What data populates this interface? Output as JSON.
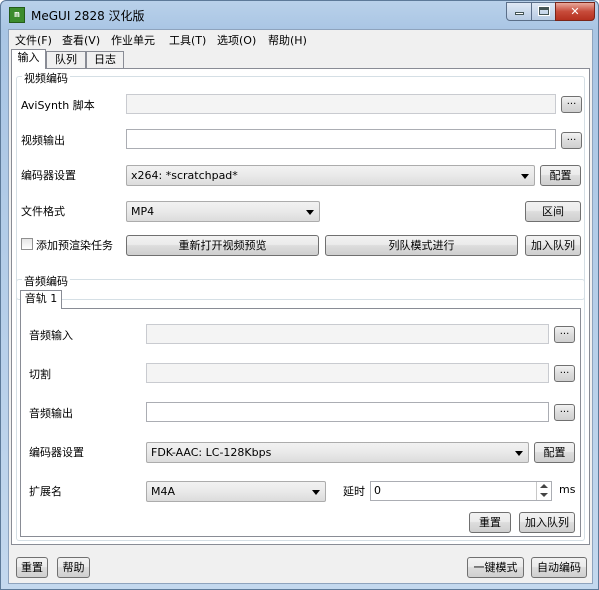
{
  "window": {
    "title": "MeGUI 2828 汉化版",
    "icon_text": "m"
  },
  "menu": [
    "文件(F)",
    "查看(V)",
    "作业单元",
    "工具(T)",
    "选项(O)",
    "帮助(H)"
  ],
  "main_tabs": [
    "输入",
    "队列",
    "日志"
  ],
  "video": {
    "group_title": "视频编码",
    "avisynth_label": "AviSynth 脚本",
    "avisynth_value": "",
    "output_label": "视频输出",
    "output_value": "",
    "encoder_label": "编码器设置",
    "encoder_value": "x264: *scratchpad*",
    "config_button": "配置",
    "format_label": "文件格式",
    "format_value": "MP4",
    "range_button": "区间",
    "prerender_label": "添加预渲染任务",
    "preview_button": "重新打开视频预览",
    "queue_mode_button": "列队模式进行",
    "add_queue_button": "加入队列"
  },
  "audio": {
    "group_title": "音频编码",
    "track_tab": "音轨 1",
    "input_label": "音频输入",
    "input_value": "",
    "cut_label": "切割",
    "cut_value": "",
    "output_label": "音频输出",
    "output_value": "",
    "encoder_label": "编码器设置",
    "encoder_value": "FDK-AAC: LC-128Kbps",
    "config_button": "配置",
    "ext_label": "扩展名",
    "ext_value": "M4A",
    "delay_label": "延时",
    "delay_value": "0",
    "delay_unit": "ms",
    "reset_button": "重置",
    "add_queue_button": "加入队列"
  },
  "footer": {
    "reset_button": "重置",
    "help_button": "帮助",
    "oneclick_button": "一键模式",
    "autoencode_button": "自动编码"
  },
  "dots": "..."
}
